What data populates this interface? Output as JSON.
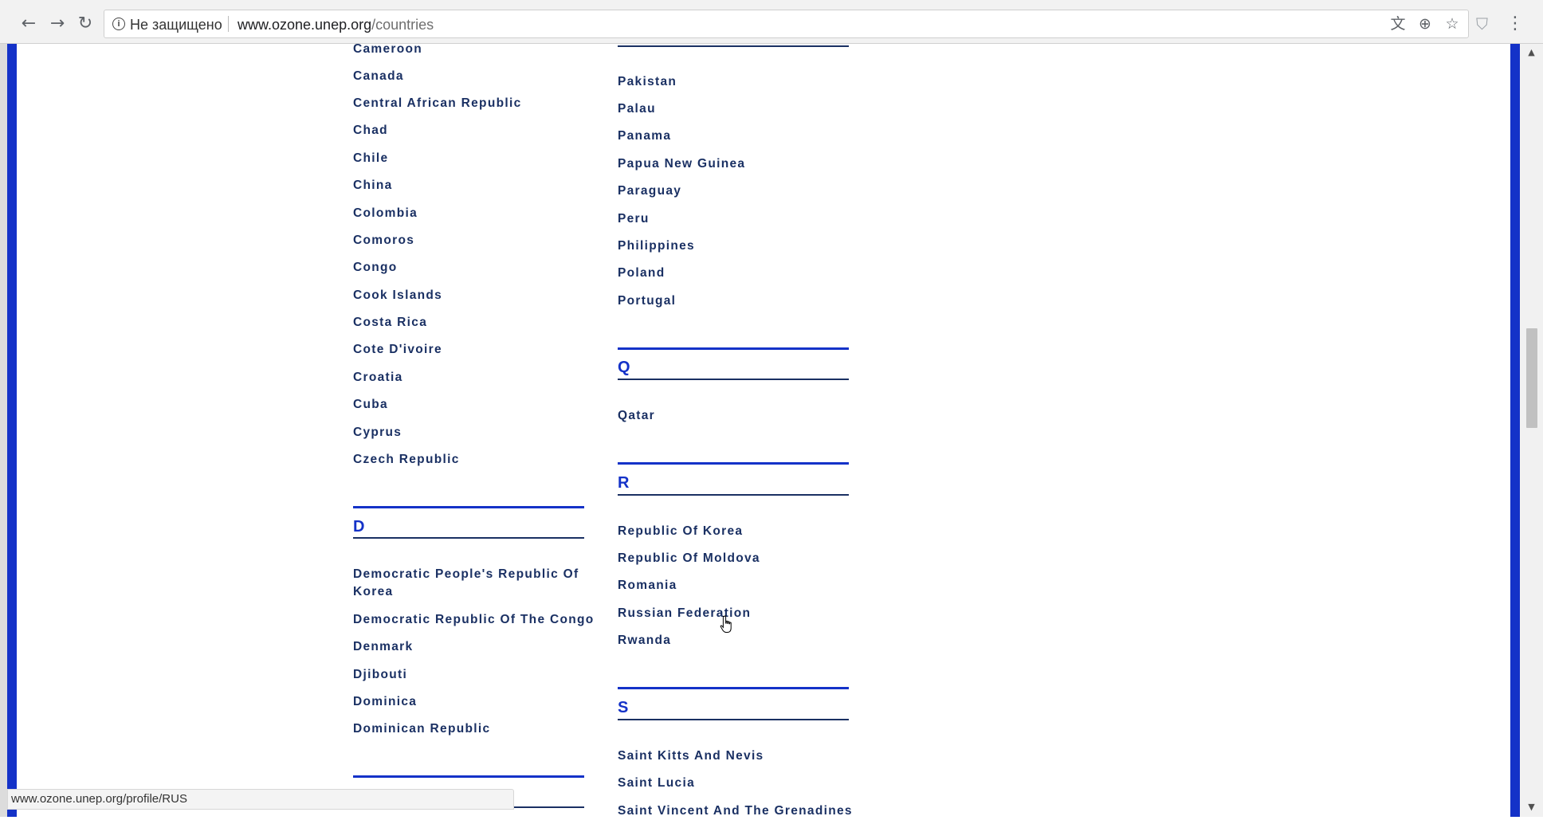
{
  "browser": {
    "security_label": "Не защищено",
    "url_host": "www.ozone.unep.org",
    "url_path": "/countries",
    "status_url": "www.ozone.unep.org/profile/RUS",
    "icons": [
      "back-icon",
      "forward-icon",
      "reload-icon",
      "info-icon",
      "translate-icon",
      "zoom-icon",
      "bookmark-star-icon",
      "extension-shield-icon",
      "menu-icon"
    ]
  },
  "colors": {
    "accent_blue": "#1432c8",
    "link_navy": "#1a3063"
  },
  "left_column": {
    "c_countries": [
      "Cameroon",
      "Canada",
      "Central African Republic",
      "Chad",
      "Chile",
      "China",
      "Colombia",
      "Comoros",
      "Congo",
      "Cook Islands",
      "Costa Rica",
      "Cote D'ivoire",
      "Croatia",
      "Cuba",
      "Cyprus",
      "Czech Republic"
    ],
    "d_letter": "D",
    "d_countries": [
      "Democratic People's Republic Of Korea",
      "Democratic Republic Of The Congo",
      "Denmark",
      "Djibouti",
      "Dominica",
      "Dominican Republic"
    ]
  },
  "right_column": {
    "p_countries": [
      "Pakistan",
      "Palau",
      "Panama",
      "Papua New Guinea",
      "Paraguay",
      "Peru",
      "Philippines",
      "Poland",
      "Portugal"
    ],
    "q_letter": "Q",
    "q_countries": [
      "Qatar"
    ],
    "r_letter": "R",
    "r_countries": [
      "Republic Of Korea",
      "Republic Of Moldova",
      "Romania",
      "Russian Federation",
      "Rwanda"
    ],
    "s_letter": "S",
    "s_countries": [
      "Saint Kitts And Nevis",
      "Saint Lucia",
      "Saint Vincent And The Grenadines"
    ]
  }
}
